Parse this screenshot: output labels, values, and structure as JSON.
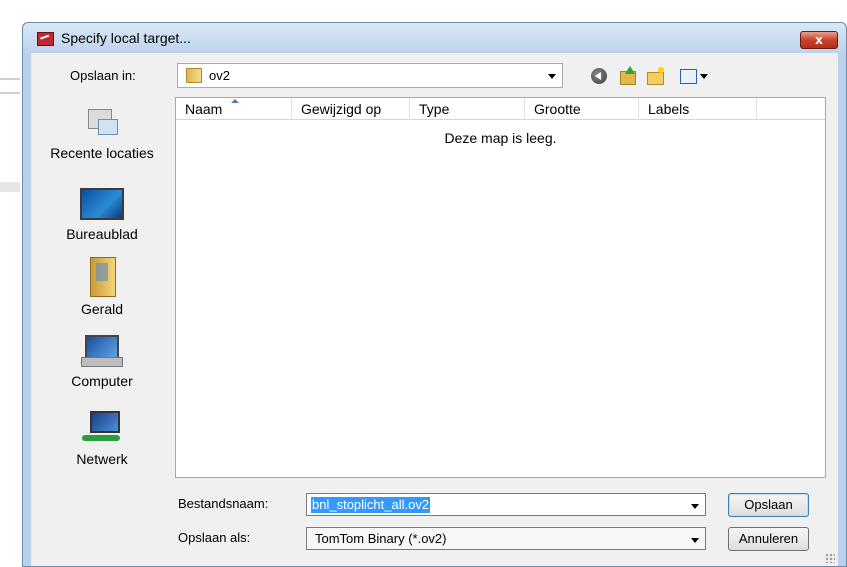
{
  "window": {
    "title": "Specify local target...",
    "close_label": "x"
  },
  "lookin": {
    "label": "Opslaan in:",
    "value": "ov2"
  },
  "toolbar": {
    "icons": [
      "back-icon",
      "up-folder-icon",
      "new-folder-icon",
      "views-menu-icon"
    ]
  },
  "places": [
    {
      "label": "Recente locaties",
      "icon": "recent-places-icon"
    },
    {
      "label": "Bureaublad",
      "icon": "desktop-icon"
    },
    {
      "label": "Gerald",
      "icon": "user-folder-icon"
    },
    {
      "label": "Computer",
      "icon": "computer-icon"
    },
    {
      "label": "Netwerk",
      "icon": "network-icon"
    }
  ],
  "filelist": {
    "columns": [
      "Naam",
      "Gewijzigd op",
      "Type",
      "Grootte",
      "Labels"
    ],
    "empty_message": "Deze map is leeg."
  },
  "filename": {
    "label": "Bestandsnaam:",
    "value": "bnl_stoplicht_all.ov2"
  },
  "saveas": {
    "label": "Opslaan als:",
    "value": "TomTom Binary (*.ov2)"
  },
  "buttons": {
    "save": "Opslaan",
    "cancel": "Annuleren"
  },
  "colors": {
    "selection": "#3399ff",
    "dialog_frame": "#b9d1ea"
  }
}
